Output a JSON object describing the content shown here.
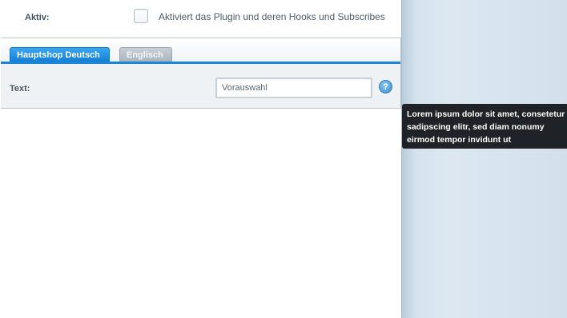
{
  "form": {
    "aktiv_label": "Aktiv:",
    "aktiv_checkbox_label": "Aktiviert das Plugin und deren Hooks und Subscribes",
    "tabs": [
      {
        "label": "Hauptshop Deutsch",
        "active": true
      },
      {
        "label": "Englisch",
        "active": false
      }
    ],
    "text_label": "Text:",
    "text_value": "Vorauswahl",
    "help_icon": "question-mark-icon"
  },
  "tooltip": {
    "text": "Lorem ipsum dolor sit amet, consetetur sadipscing elitr, sed diam nonumy eirmod tempor invidunt ut"
  },
  "colors": {
    "accent": "#1b86d6",
    "tooltip_bg": "#1f2327",
    "background": "#d6e3ee"
  }
}
